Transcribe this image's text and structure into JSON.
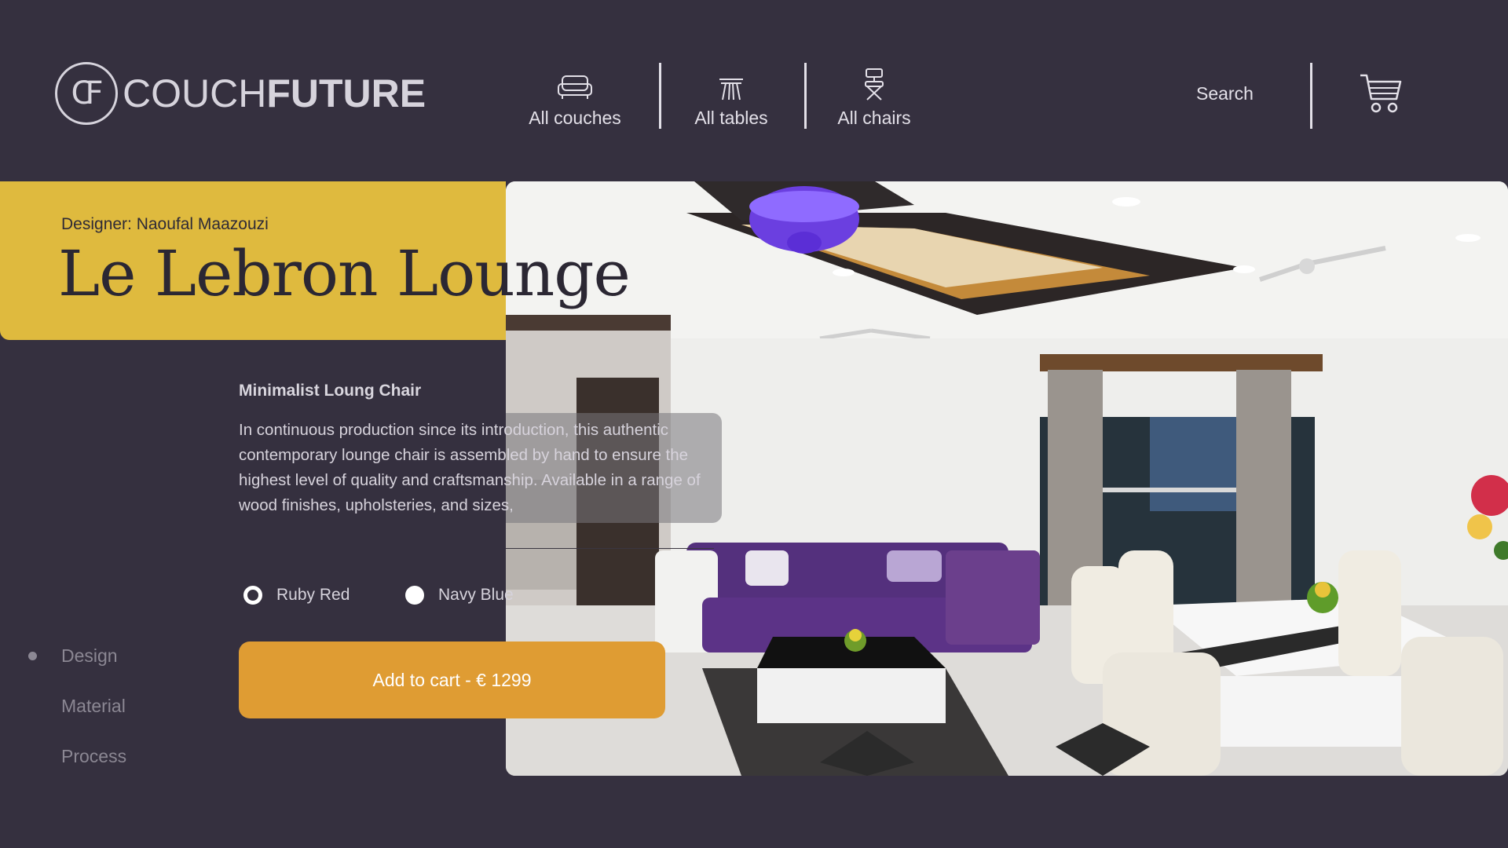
{
  "brand": {
    "mark": "CF",
    "name_light": "COUCH",
    "name_bold": "FUTURE"
  },
  "nav": {
    "items": [
      {
        "label": "All couches",
        "icon": "couch-icon"
      },
      {
        "label": "All tables",
        "icon": "table-icon"
      },
      {
        "label": "All chairs",
        "icon": "chair-icon"
      }
    ],
    "search_label": "Search",
    "cart_icon": "cart-icon"
  },
  "product": {
    "designer": "Designer: Naoufal Maazouzi",
    "title": "Le Lebron Lounge",
    "subtitle": "Minimalist Loung Chair",
    "description": "In continuous production since its introduction, this authentic contemporary lounge chair is assembled by hand to ensure the highest level of quality and craftsmanship. Available in a range of wood finishes, upholsteries, and sizes,",
    "colors": [
      {
        "label": "Ruby Red",
        "selected": true
      },
      {
        "label": "Navy Blue",
        "selected": false
      }
    ],
    "cta_label": "Add to cart -  € 1299"
  },
  "side_nav": {
    "items": [
      "Design",
      "Material",
      "Process"
    ],
    "active_index": 0
  },
  "theme": {
    "background": "#35303f",
    "accent_yellow": "#dfba3e",
    "cta_orange": "#df9c33",
    "text_light": "#e3e0e8"
  }
}
